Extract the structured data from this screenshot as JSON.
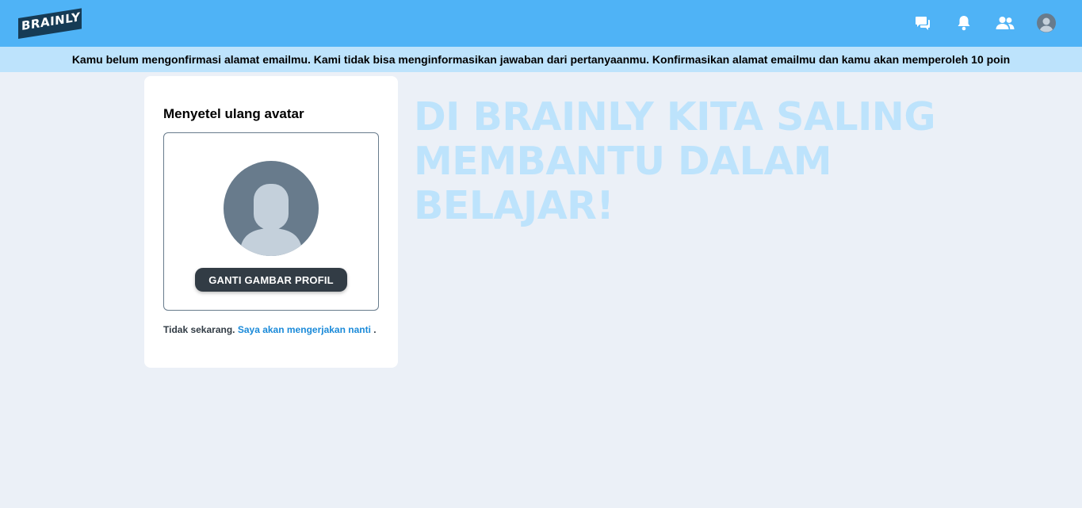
{
  "header": {
    "logo_text": "BRAINLY",
    "icons": [
      "messages-icon",
      "notifications-icon",
      "friends-icon",
      "profile-avatar-icon"
    ]
  },
  "banner": {
    "text": "Kamu belum mengonfirmasi alamat emailmu. Kami tidak bisa menginformasikan jawaban dari pertanyaanmu. Konfirmasikan alamat emailmu dan kamu akan memperoleh 10 poin"
  },
  "card": {
    "title": "Menyetel ulang avatar",
    "change_button": "GANTI GAMBAR PROFIL",
    "later_prefix": "Tidak sekarang.",
    "later_link": "Saya akan mengerjakan nanti",
    "later_suffix": "."
  },
  "headline": {
    "line1": "DI BRAINLY KITA SALING",
    "line2": "MEMBANTU DALAM",
    "line3": "BELAJAR!"
  },
  "colors": {
    "topbar": "#4fb3f6",
    "banner": "#bde3fc",
    "background": "#ebf0f7",
    "button": "#323c45",
    "link": "#1a8ad9",
    "headline": "#bde3fc"
  }
}
